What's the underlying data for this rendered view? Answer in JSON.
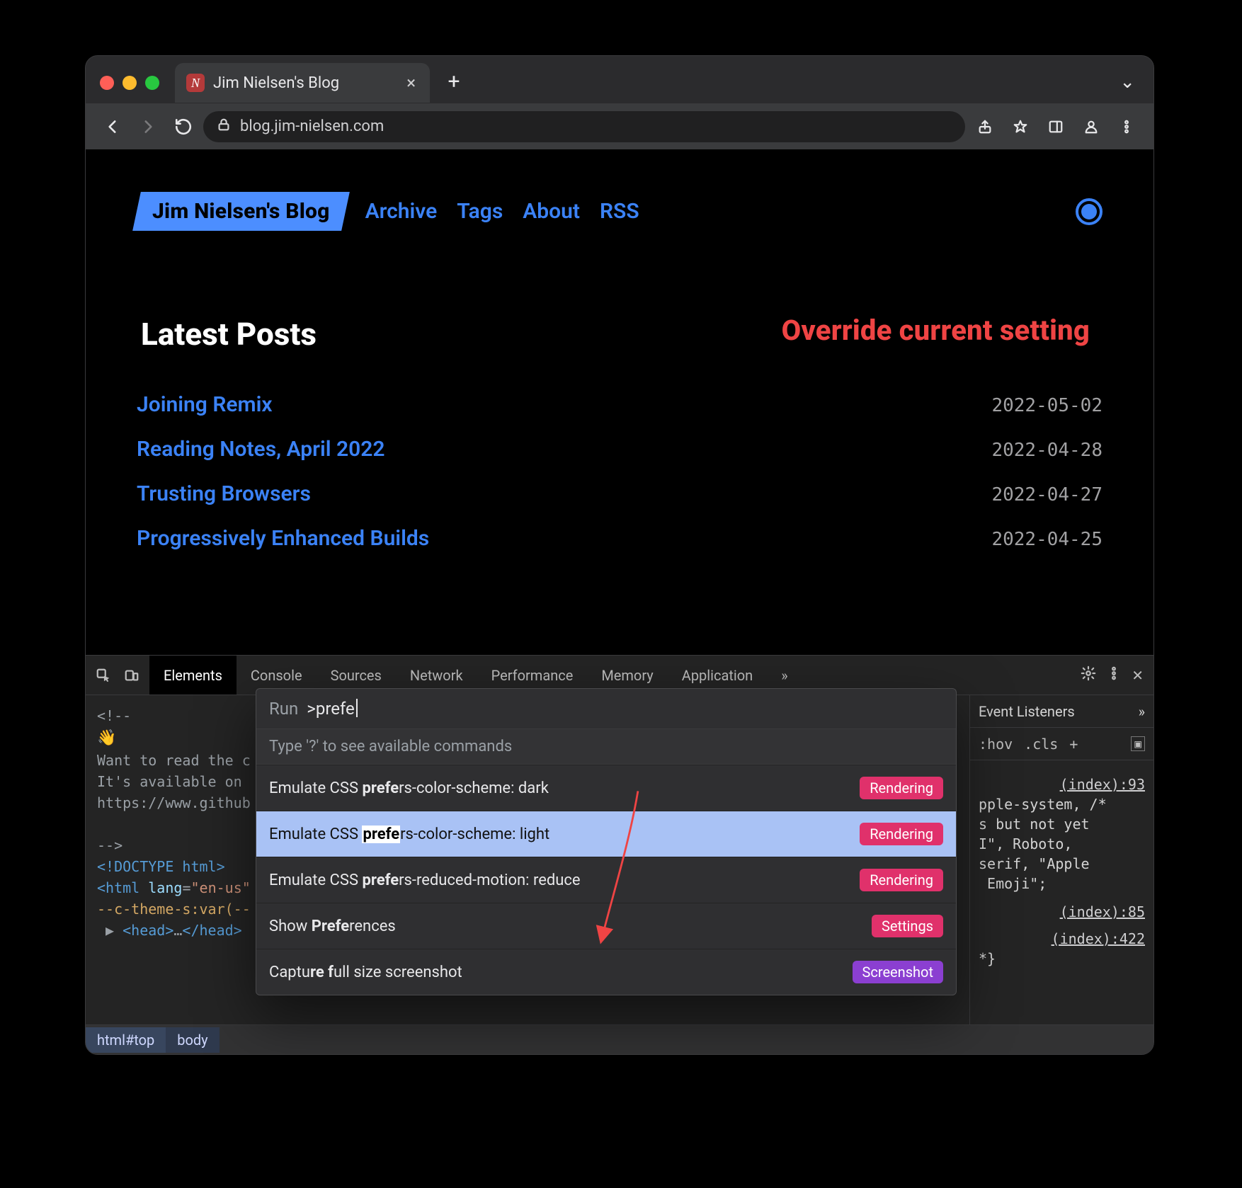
{
  "window": {
    "tab_title": "Jim Nielsen's Blog",
    "favicon_letter": "N",
    "url_display": "blog.jim-nielsen.com"
  },
  "site": {
    "brand": "Jim Nielsen's Blog",
    "nav": [
      "Archive",
      "Tags",
      "About",
      "RSS"
    ],
    "section_title": "Latest Posts",
    "posts": [
      {
        "title": "Joining Remix",
        "date": "2022-05-02"
      },
      {
        "title": "Reading Notes, April 2022",
        "date": "2022-04-28"
      },
      {
        "title": "Trusting Browsers",
        "date": "2022-04-27"
      },
      {
        "title": "Progressively Enhanced Builds",
        "date": "2022-04-25"
      }
    ]
  },
  "annotation": {
    "text": "Override current setting",
    "color": "#ef4444"
  },
  "devtools": {
    "tabs": [
      "Elements",
      "Console",
      "Sources",
      "Network",
      "Performance",
      "Memory",
      "Application"
    ],
    "active_tab": "Elements",
    "right_panel": {
      "header_items": [
        "Event Listeners"
      ],
      "toolbar": [
        ":hov",
        ".cls",
        "+"
      ],
      "entries": [
        {
          "idx": "(index):93",
          "css": "pple-system, /*\ns but not yet\nI\", Roboto,\nserif, \"Apple\n Emoji\";"
        },
        {
          "idx": "(index):85",
          "css": ""
        },
        {
          "idx": "(index):422",
          "css": "*}"
        }
      ]
    },
    "source_lines": [
      "<!--",
      "👋",
      "Want to read the c",
      "It's available on",
      "https://www.github",
      "",
      "-->",
      "<!DOCTYPE html>",
      "<html lang=\"en-us\"",
      "--c-theme-s:var(--",
      " ▶ <head>…</head>"
    ],
    "crumbs": [
      "html#top",
      "body"
    ]
  },
  "command_menu": {
    "prompt_label": "Run",
    "prompt_prefix": ">",
    "typed": "prefe",
    "hint": "Type '?' to see available commands",
    "items": [
      {
        "pre": "Emulate CSS ",
        "bold": "prefe",
        "post": "rs-color-scheme: dark",
        "badge": "Rendering",
        "badge_class": "render",
        "selected": false
      },
      {
        "pre": "Emulate CSS ",
        "bold": "prefe",
        "post": "rs-color-scheme: light",
        "badge": "Rendering",
        "badge_class": "render",
        "selected": true
      },
      {
        "pre": "Emulate CSS ",
        "bold": "prefe",
        "post": "rs-reduced-motion: reduce",
        "badge": "Rendering",
        "badge_class": "render",
        "selected": false
      },
      {
        "pre": "Show ",
        "bold": "Prefe",
        "post": "rences",
        "badge": "Settings",
        "badge_class": "settings",
        "selected": false
      },
      {
        "pre": "Captu",
        "bold": "re f",
        "post": "ull size screenshot",
        "badge": "Screenshot",
        "badge_class": "shot",
        "selected": false
      }
    ]
  }
}
